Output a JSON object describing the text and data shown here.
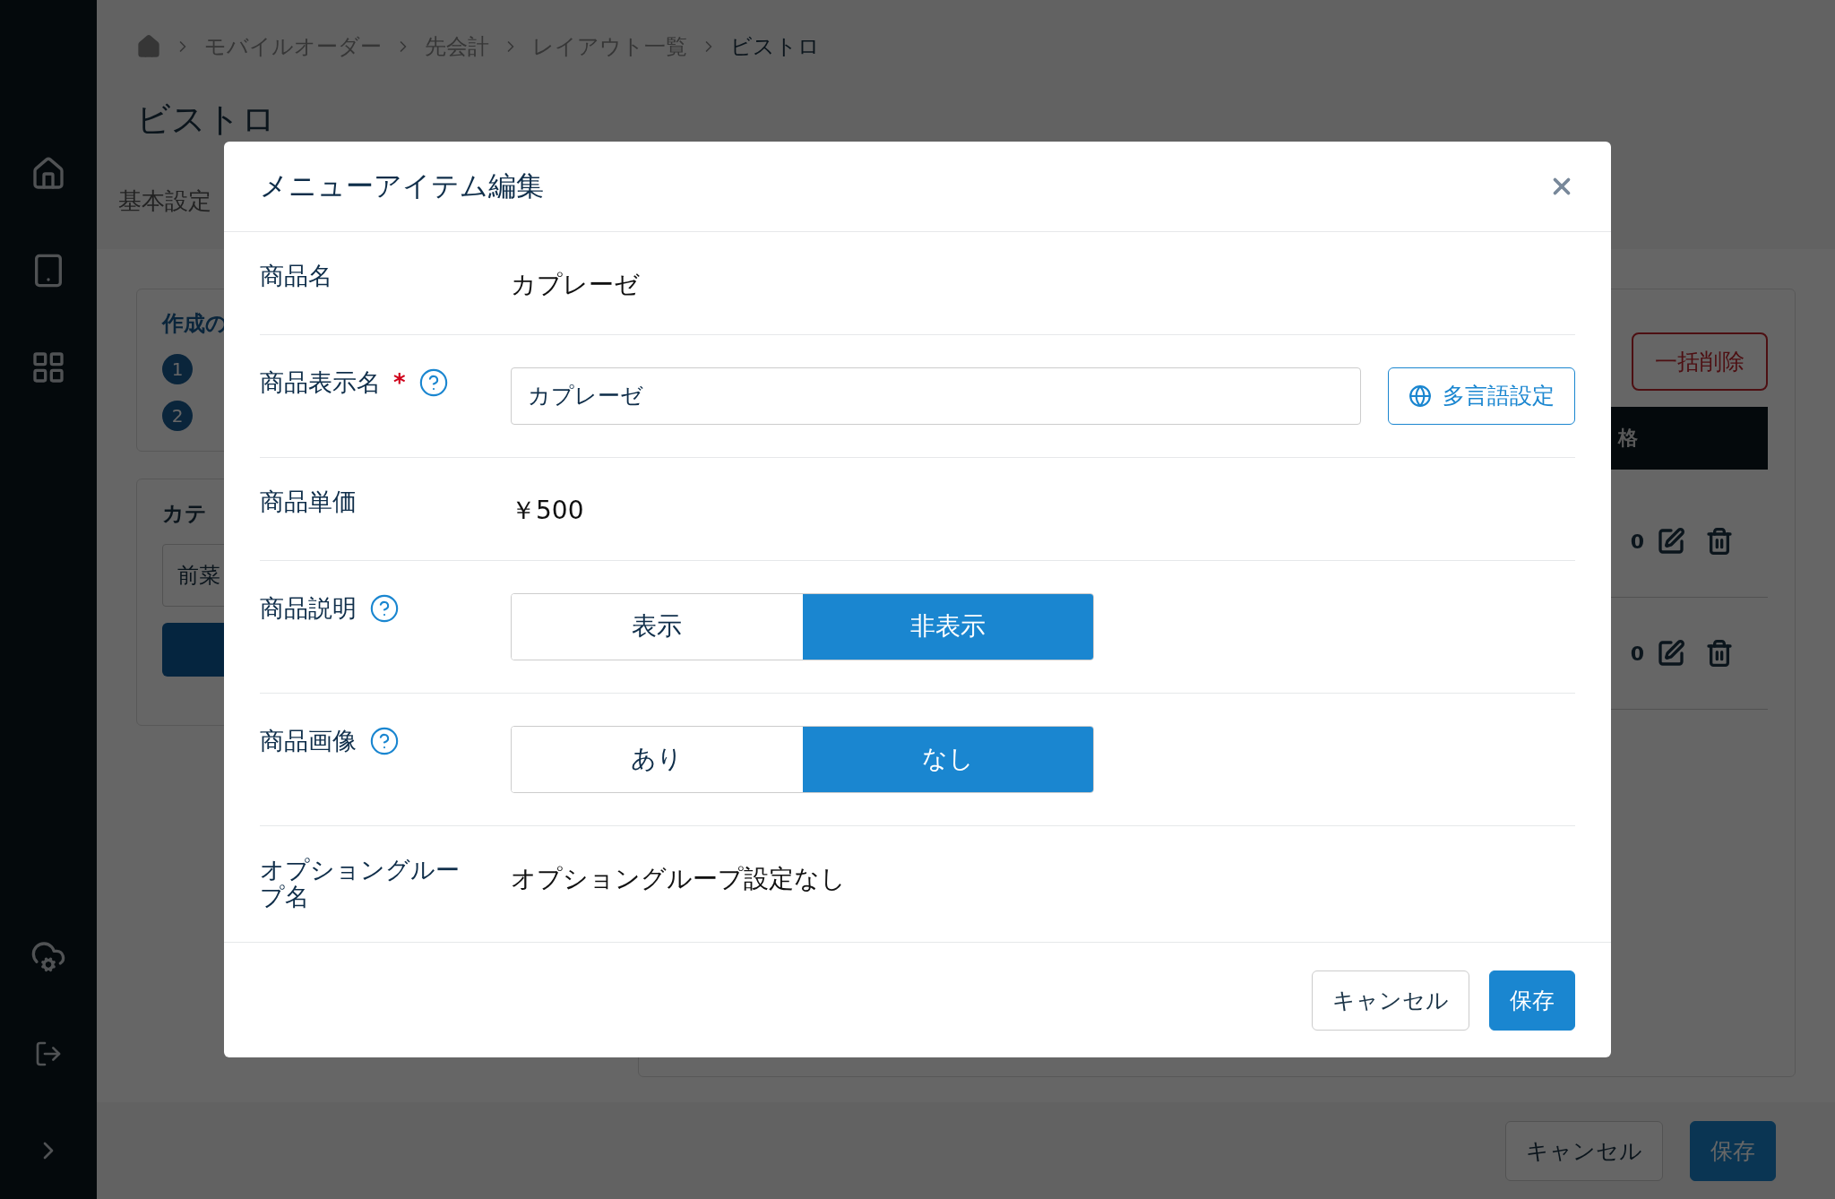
{
  "breadcrumb": [
    "モバイルオーダー",
    "先会計",
    "レイアウト一覧",
    "ビストロ"
  ],
  "page_title": "ビストロ",
  "tab": "基本設定",
  "steps_card": {
    "title": "作成の",
    "steps": [
      "1",
      "2"
    ]
  },
  "category_card": {
    "title": "カテ",
    "field_value": "前菜"
  },
  "items_card": {
    "bulk_delete": "一括削除",
    "header": "格",
    "rows": [
      "0",
      "0"
    ]
  },
  "footer": {
    "cancel": "キャンセル",
    "save": "保存"
  },
  "modal": {
    "title": "メニューアイテム編集",
    "rows": [
      {
        "kind": "text",
        "label": "商品名",
        "value": "カプレーゼ"
      },
      {
        "kind": "input",
        "label": "商品表示名",
        "required_mark": "*",
        "help": true,
        "value": "カプレーゼ",
        "button": "多言語設定"
      },
      {
        "kind": "text",
        "label": "商品単価",
        "value": "￥500"
      },
      {
        "kind": "toggle",
        "label": "商品説明",
        "help": true,
        "options": [
          {
            "label": "表示",
            "selected": false
          },
          {
            "label": "非表示",
            "selected": true
          }
        ]
      },
      {
        "kind": "toggle",
        "label": "商品画像",
        "help": true,
        "options": [
          {
            "label": "あり",
            "selected": false
          },
          {
            "label": "なし",
            "selected": true
          }
        ]
      },
      {
        "kind": "text",
        "label": "オプショングループ名",
        "value": "オプショングループ設定なし"
      }
    ],
    "cancel": "キャンセル",
    "save": "保存"
  }
}
